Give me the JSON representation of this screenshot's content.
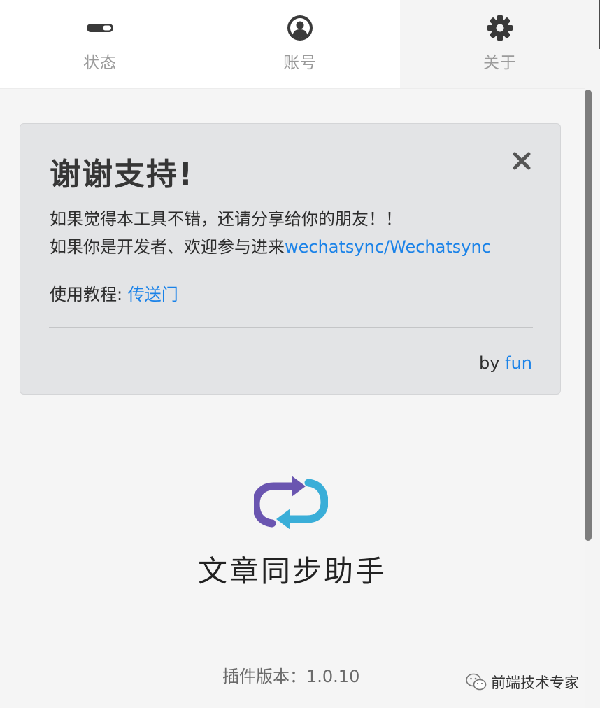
{
  "tabs": [
    {
      "label": "状态",
      "icon": "toggle-icon",
      "active": false
    },
    {
      "label": "账号",
      "icon": "user-circle-icon",
      "active": false
    },
    {
      "label": "关于",
      "icon": "gear-icon",
      "active": true
    }
  ],
  "alert": {
    "title": "谢谢支持!",
    "close_icon": "close-icon",
    "line1": "如果觉得本工具不错，还请分享给你的朋友！！",
    "line2_prefix": "如果你是开发者、欢迎参与进来",
    "line2_link": "wechatsync/Wechatsync",
    "line3_prefix": "使用教程: ",
    "line3_link": "传送门",
    "by_prefix": "by ",
    "by_link": "fun"
  },
  "app": {
    "logo_icon": "sync-arrows-icon",
    "name": "文章同步助手",
    "version": "插件版本：1.0.10"
  },
  "watermark": {
    "icon": "wechat-icon",
    "text": "前端技术专家"
  },
  "colors": {
    "link": "#1a82e8",
    "alert_bg": "#e3e4e6",
    "logo_purple": "#6a55b0",
    "logo_cyan": "#3aaed8"
  }
}
